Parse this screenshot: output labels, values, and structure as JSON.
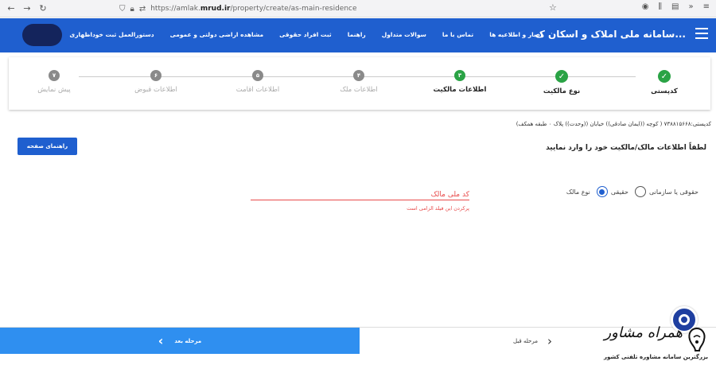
{
  "browser": {
    "url_prefix": "https://amlak.",
    "url_domain": "mrud.ir",
    "url_path": "/property/create/as-main-residence"
  },
  "header": {
    "title": "سامانه ملی املاک و اسکان ک...",
    "menu": [
      "اخبار و اطلاعیه ها",
      "تماس با ما",
      "سوالات متداول",
      "راهنما",
      "ثبت افراد حقوقی",
      "مشاهده اراضی دولتی و عمومی",
      "دستورالعمل ثبت خوداظهاری"
    ]
  },
  "steps": [
    {
      "label": "کدپستی",
      "marker": "✓",
      "state": "done"
    },
    {
      "label": "نوع مالکیت",
      "marker": "✓",
      "state": "done"
    },
    {
      "label": "اطلاعات مالکیت",
      "marker": "۳",
      "state": "current"
    },
    {
      "label": "اطلاعات ملک",
      "marker": "۴",
      "state": "todo"
    },
    {
      "label": "اطلاعات اقامت",
      "marker": "۵",
      "state": "todo"
    },
    {
      "label": "اطلاعات قبوض",
      "marker": "۶",
      "state": "todo"
    },
    {
      "label": "پیش نمایش",
      "marker": "۷",
      "state": "todo"
    }
  ],
  "form": {
    "address": "کدپستی:۷۳۸۸۱۵۶۶۸ ( کوچه ((ایمان صادقی)) خیابان ((وحدت)) پلاک ۰ طبقه همکف)",
    "guide_button": "راهنمای صفحه",
    "instruction": "لطفاً اطلاعات مالک/مالکیت خود را وارد نمایید",
    "owner_type_label": "نوع مالک",
    "option_real": "حقیقی",
    "option_legal": "حقوقی یا سازمانی",
    "selected_option": "حقیقی",
    "national_id_placeholder": "کد ملی مالک",
    "national_id_error": "پرکردن این فیلد الزامی است"
  },
  "footer": {
    "next_label": "مرحله بعد",
    "prev_label": "مرحله قبل"
  },
  "watermark": {
    "title": "همراه مشاور",
    "subtitle": "بزرگترین سامانه مشاوره تلفنی کشور"
  },
  "colors": {
    "brand_blue": "#1f5fcf",
    "next_blue": "#2f8ff0",
    "success_green": "#2aa345",
    "error_red": "#e84a4a"
  }
}
